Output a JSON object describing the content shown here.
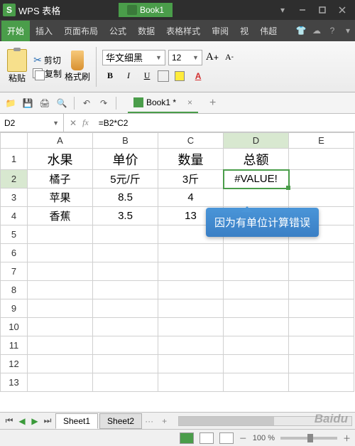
{
  "app": {
    "name": "WPS 表格",
    "doc": "Book1",
    "doc_tab": "Book1 *"
  },
  "menu": {
    "items": [
      "开始",
      "插入",
      "页面布局",
      "公式",
      "数据",
      "表格样式",
      "审阅",
      "视",
      "",
      "伟超"
    ]
  },
  "ribbon": {
    "paste": "粘贴",
    "cut": "剪切",
    "copy": "复制",
    "format_painter": "格式刷",
    "font_name": "华文细黑",
    "font_size": "12",
    "bold": "B",
    "italic": "I",
    "underline": "U",
    "increase": "A",
    "decrease": "A"
  },
  "quick": {
    "doc_tab": "Book1 *"
  },
  "formula": {
    "cell": "D2",
    "fx": "fx",
    "value": "=B2*C2"
  },
  "cols": [
    "A",
    "B",
    "C",
    "D",
    "E"
  ],
  "rows": [
    "1",
    "2",
    "3",
    "4",
    "5",
    "6",
    "7",
    "8",
    "9",
    "10",
    "11",
    "12",
    "13"
  ],
  "cells": {
    "A1": "水果",
    "B1": "单价",
    "C1": "数量",
    "D1": "总额",
    "A2": "橘子",
    "B2": "5元/斤",
    "C2": "3斤",
    "D2": "#VALUE!",
    "A3": "苹果",
    "B3": "8.5",
    "C3": "4",
    "A4": "香蕉",
    "B4": "3.5",
    "C4": "13"
  },
  "callout": "因为有单位计算错误",
  "sheets": {
    "tabs": [
      "Sheet1",
      "Sheet2"
    ],
    "ellipsis": "···",
    "plus": "+"
  },
  "status": {
    "zoom": "100 %",
    "minus": "－",
    "plus": "＋"
  },
  "watermark": "Baidu"
}
